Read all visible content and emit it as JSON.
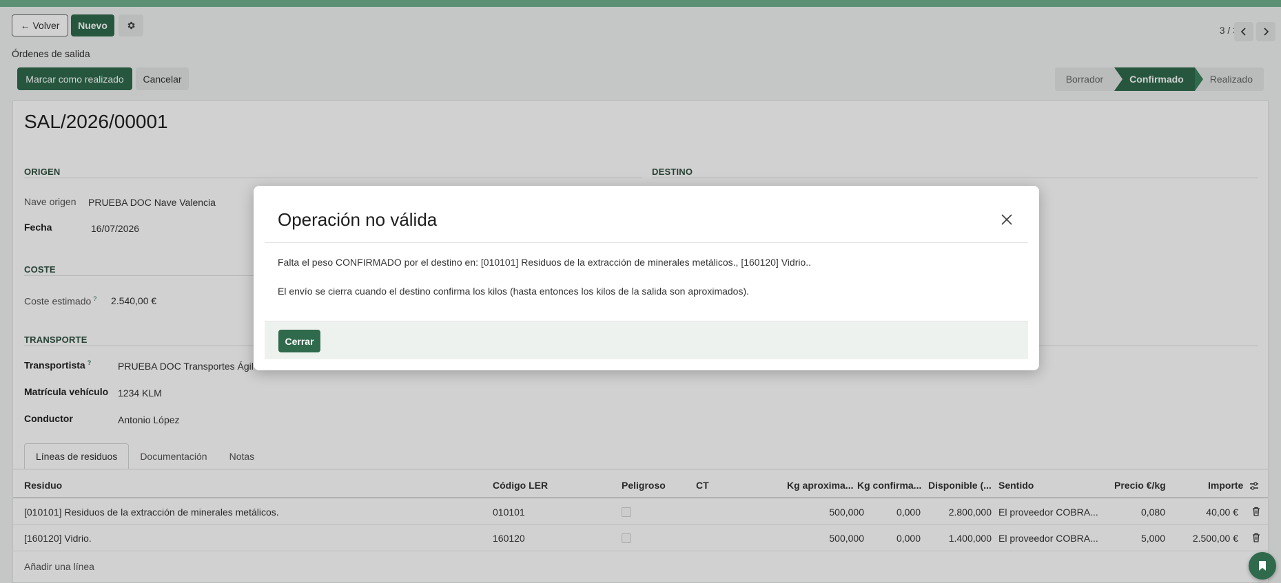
{
  "control_panel": {
    "back_label": "← Volver",
    "new_label": "Nuevo",
    "gear_icon": "gear-icon",
    "breadcrumb": "Órdenes de salida",
    "pager": "3 / 3",
    "mark_done_label": "Marcar como realizado",
    "cancel_label": "Cancelar"
  },
  "statusbar": {
    "states": [
      "Borrador",
      "Confirmado",
      "Realizado"
    ],
    "active": "Confirmado"
  },
  "record": {
    "name": "SAL/2026/00001",
    "origen": {
      "title": "ORIGEN",
      "nave_label": "Nave origen",
      "nave_value": "PRUEBA DOC Nave Valencia",
      "fecha_label": "Fecha",
      "fecha_value": "16/07/2026"
    },
    "destino": {
      "title": "DESTINO"
    },
    "coste": {
      "title": "COSTE",
      "label": "Coste estimado",
      "help": "?",
      "value": "2.540,00 €"
    },
    "transporte": {
      "title": "TRANSPORTE",
      "transportista_label": "Transportista",
      "transportista_help": "?",
      "transportista_value": "PRUEBA DOC Transportes Ágil S",
      "matricula_label": "Matrícula vehículo",
      "matricula_value": "1234 KLM",
      "conductor_label": "Conductor",
      "conductor_value": "Antonio López"
    }
  },
  "tabs": [
    "Líneas de residuos",
    "Documentación",
    "Notas"
  ],
  "table": {
    "headers": [
      "Residuo",
      "Código LER",
      "Peligroso",
      "CT",
      "Kg aproxima...",
      "Kg confirma...",
      "Disponible (...",
      "Sentido",
      "Precio €/kg",
      "Importe"
    ],
    "rows": [
      [
        "[010101] Residuos de la extracción de minerales metálicos.",
        "010101",
        "",
        "",
        "500,000",
        "0,000",
        "2.800,000",
        "El proveedor COBRA...",
        "0,080",
        "40,00 €"
      ],
      [
        "[160120] Vidrio.",
        "160120",
        "",
        "",
        "500,000",
        "0,000",
        "1.400,000",
        "El proveedor COBRA...",
        "5,000",
        "2.500,00 €"
      ]
    ],
    "add_line": "Añadir una línea"
  },
  "dialog": {
    "title": "Operación no válida",
    "message_1": "Falta el peso CONFIRMADO por el destino en: [010101] Residuos de la extracción de minerales metálicos., [160120] Vidrio..",
    "message_2": "El envío se cierra cuando el destino confirma los kilos (hasta entonces los kilos de la salida son aproximados).",
    "close_label": "Cerrar"
  },
  "colors": {
    "primary": "#2f6a4c",
    "topbar": "#71b08e"
  }
}
